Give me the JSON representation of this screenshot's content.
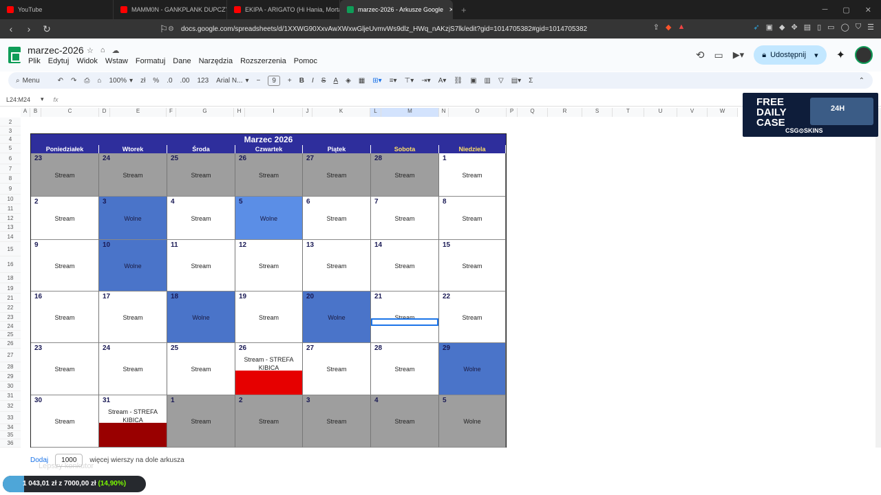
{
  "browser": {
    "tabs": [
      {
        "label": "YouTube",
        "fav_color": "#ff0000"
      },
      {
        "label": "MAMM0N - GANKPLANK DUPCZY I...",
        "fav_color": "#ff0000"
      },
      {
        "label": "EKIPA - ARIGATO (Hi Hania, Mortal, S...",
        "fav_color": "#ff0000"
      },
      {
        "label": "marzec-2026 - Arkusze Google",
        "fav_color": "#0f9d58"
      }
    ],
    "url": "docs.google.com/spreadsheets/d/1XXWG90XxvAwXWxwGljeUvmvWs9dlz_HWq_nAKzjS7lk/edit?gid=1014705382#gid=1014705382"
  },
  "sheets": {
    "doc_title": "marzec-2026",
    "menus": [
      "Plik",
      "Edytuj",
      "Widok",
      "Wstaw",
      "Formatuj",
      "Dane",
      "Narzędzia",
      "Rozszerzenia",
      "Pomoc"
    ],
    "share_label": "Udostępnij",
    "toolbar": {
      "menu": "Menu",
      "zoom": "100%",
      "currency": "zł",
      "percent": "%",
      "dec_dec": ".0",
      "dec_inc": ".00",
      "numfmt": "123",
      "font": "Arial N...",
      "font_size": "9"
    },
    "cell_ref": "L24:M24",
    "fx": "fx",
    "columns": [
      "A",
      "B",
      "C",
      "D",
      "E",
      "F",
      "G",
      "H",
      "I",
      "J",
      "K",
      "L",
      "M",
      "N",
      "O",
      "P",
      "Q",
      "R",
      "S",
      "T",
      "U",
      "V",
      "W"
    ],
    "rows": [
      "2",
      "3",
      "4",
      "5",
      "6",
      "7",
      "8",
      "9",
      "10",
      "11",
      "12",
      "13",
      "14",
      "15",
      "16",
      "18",
      "19",
      "21",
      "22",
      "23",
      "24",
      "25",
      "26",
      "27",
      "28",
      "29",
      "30",
      "31",
      "32",
      "33",
      "34",
      "35",
      "36"
    ]
  },
  "calendar": {
    "title": "Marzec 2026",
    "days": [
      "Poniedziałek",
      "Wtorek",
      "Środa",
      "Czwartek",
      "Piątek",
      "Sobota",
      "Niedziela"
    ],
    "weeks": [
      [
        {
          "n": "23",
          "t": "Stream",
          "c": "grey"
        },
        {
          "n": "24",
          "t": "Stream",
          "c": "grey"
        },
        {
          "n": "25",
          "t": "Stream",
          "c": "grey"
        },
        {
          "n": "26",
          "t": "Stream",
          "c": "grey"
        },
        {
          "n": "27",
          "t": "Stream",
          "c": "grey"
        },
        {
          "n": "28",
          "t": "Stream",
          "c": "grey"
        },
        {
          "n": "1",
          "t": "Stream",
          "c": "white"
        }
      ],
      [
        {
          "n": "2",
          "t": "Stream",
          "c": "white"
        },
        {
          "n": "3",
          "t": "Wolne",
          "c": "blue"
        },
        {
          "n": "4",
          "t": "Stream",
          "c": "white"
        },
        {
          "n": "5",
          "t": "Wolne",
          "c": "lightblue"
        },
        {
          "n": "6",
          "t": "Stream",
          "c": "white"
        },
        {
          "n": "7",
          "t": "Stream",
          "c": "white"
        },
        {
          "n": "8",
          "t": "Stream",
          "c": "white"
        }
      ],
      [
        {
          "n": "9",
          "t": "Stream",
          "c": "white"
        },
        {
          "n": "10",
          "t": "Wolne",
          "c": "blue"
        },
        {
          "n": "11",
          "t": "Stream",
          "c": "white"
        },
        {
          "n": "12",
          "t": "Stream",
          "c": "white"
        },
        {
          "n": "13",
          "t": "Stream",
          "c": "white"
        },
        {
          "n": "14",
          "t": "Stream",
          "c": "white"
        },
        {
          "n": "15",
          "t": "Stream",
          "c": "white"
        }
      ],
      [
        {
          "n": "16",
          "t": "Stream",
          "c": "white"
        },
        {
          "n": "17",
          "t": "Stream",
          "c": "white"
        },
        {
          "n": "18",
          "t": "Wolne",
          "c": "blue"
        },
        {
          "n": "19",
          "t": "Stream",
          "c": "white"
        },
        {
          "n": "20",
          "t": "Wolne",
          "c": "blue"
        },
        {
          "n": "21",
          "t": "Stream",
          "c": "white"
        },
        {
          "n": "22",
          "t": "Stream",
          "c": "white"
        }
      ],
      [
        {
          "n": "23",
          "t": "Stream",
          "c": "white"
        },
        {
          "n": "24",
          "t": "Stream",
          "c": "white"
        },
        {
          "n": "25",
          "t": "Stream",
          "c": "white"
        },
        {
          "n": "26",
          "t": "Stream - STREFA KIBICA",
          "c": "white",
          "bar": "#e60000"
        },
        {
          "n": "27",
          "t": "Stream",
          "c": "white"
        },
        {
          "n": "28",
          "t": "Stream",
          "c": "white"
        },
        {
          "n": "29",
          "t": "Wolne",
          "c": "blue"
        }
      ],
      [
        {
          "n": "30",
          "t": "Stream",
          "c": "white"
        },
        {
          "n": "31",
          "t": "Stream - STREFA KIBICA",
          "c": "white",
          "bar": "#990000"
        },
        {
          "n": "1",
          "t": "Stream",
          "c": "grey"
        },
        {
          "n": "2",
          "t": "Stream",
          "c": "grey"
        },
        {
          "n": "3",
          "t": "Stream",
          "c": "grey"
        },
        {
          "n": "4",
          "t": "Stream",
          "c": "grey"
        },
        {
          "n": "5",
          "t": "Wolne",
          "c": "grey"
        }
      ]
    ],
    "colors": {
      "grey": "#9e9e9e",
      "white": "#ffffff",
      "blue": "#4a74c9",
      "lightblue": "#5b8ee6",
      "header": "#2e2e9c"
    }
  },
  "bottom": {
    "add": "Dodaj",
    "rows_value": "1000",
    "more_rows": "więcej wierszy na dole arkusza"
  },
  "overlay": {
    "label": "Lepszy konkutor",
    "progress": "1 043,01 zł z 7000,00 zł",
    "percent": "(14,90%)",
    "fraction": 0.149
  },
  "ad": {
    "line1": "FREE",
    "line2": "DAILY",
    "line3": "CASE",
    "brand": "CSG⊙SKINS"
  }
}
